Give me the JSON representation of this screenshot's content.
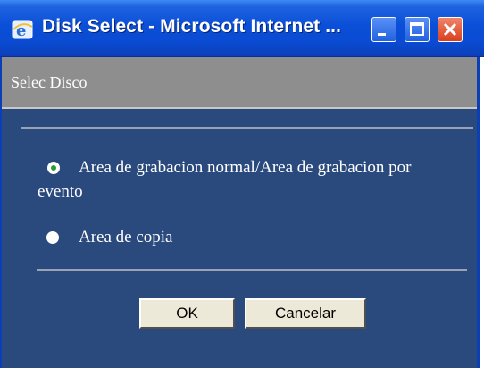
{
  "window": {
    "title": "Disk Select - Microsoft Internet ...",
    "buttons": [
      "minimize-icon",
      "maximize-icon",
      "close-icon"
    ],
    "icon": "internet-explorer-icon"
  },
  "page": {
    "title": "Selec Disco"
  },
  "options": [
    {
      "label": "Area de grabacion normal/Area de grabacion por evento",
      "checked": true
    },
    {
      "label": "Area de copia",
      "checked": false
    }
  ],
  "actions": {
    "ok_label": "OK",
    "cancel_label": "Cancelar"
  },
  "colors": {
    "titlebar": "#0b4fd8",
    "body": "#2a4a7e",
    "header": "#8e8e8e"
  }
}
